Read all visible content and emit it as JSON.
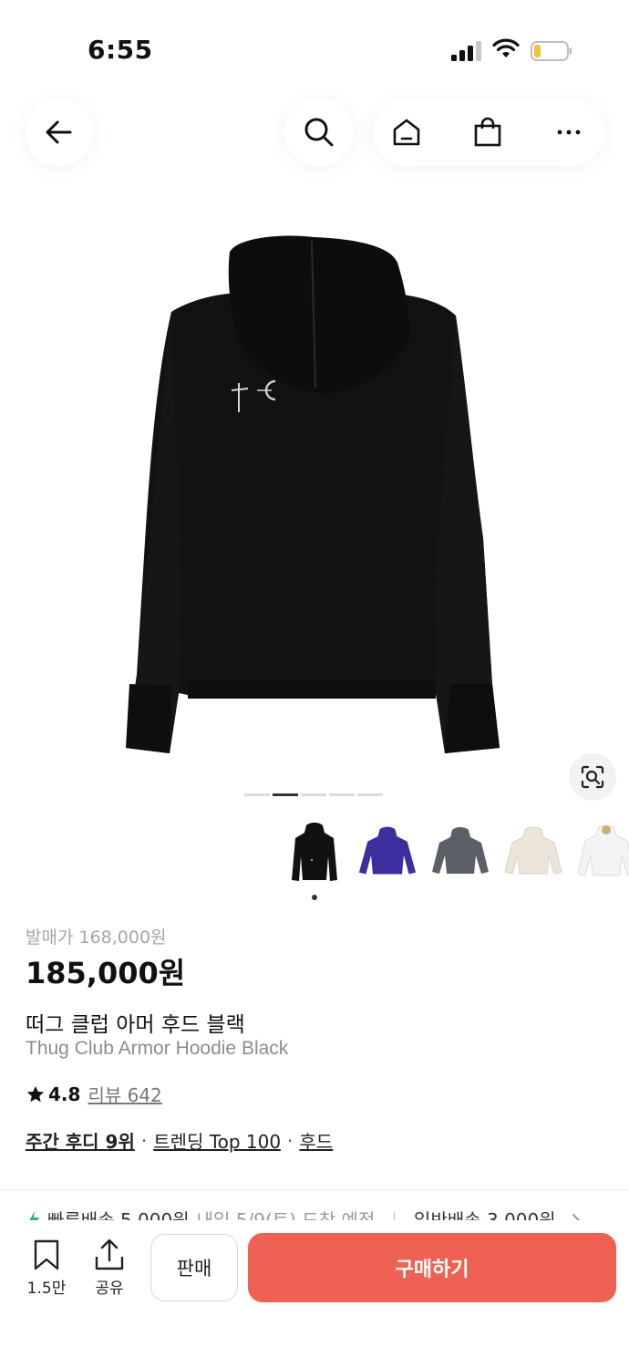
{
  "status_bar": {
    "time": "6:55"
  },
  "nav": {
    "back_icon": "arrow-left-icon",
    "search_icon": "search-icon",
    "home_icon": "home-icon",
    "cart_icon": "shopping-bag-icon",
    "more_icon": "more-horizontal-icon"
  },
  "gallery": {
    "page_count": 5,
    "current_page": 2,
    "thumbnails": [
      {
        "color": "#111111",
        "label": "black"
      },
      {
        "color": "#3b2fa0",
        "label": "purple"
      },
      {
        "color": "#5a5f68",
        "label": "charcoal"
      },
      {
        "color": "#ece6da",
        "label": "cream"
      },
      {
        "color": "#f3f3f3",
        "label": "white"
      }
    ]
  },
  "product": {
    "release_price": "발매가 168,000원",
    "price": "185,000원",
    "name_ko": "떠그 클럽 아머 후드 블랙",
    "name_en": "Thug Club Armor Hoodie Black",
    "rating": "4.8",
    "review_label": "리뷰 642",
    "tags": [
      "주간 후디 9위",
      "트렌딩 Top 100",
      "후드"
    ]
  },
  "shipping": {
    "fast": "빠른배송 5,000원",
    "fast_date": "내일 5/9(토) 도착 예정",
    "normal": "일반배송 3,000원"
  },
  "bottom_bar": {
    "bookmark_count": "1.5만",
    "share_label": "공유",
    "sell_label": "판매",
    "buy_label": "구매하기"
  },
  "colors": {
    "accent": "#ef6253",
    "fast_ship": "#2fb56a"
  }
}
